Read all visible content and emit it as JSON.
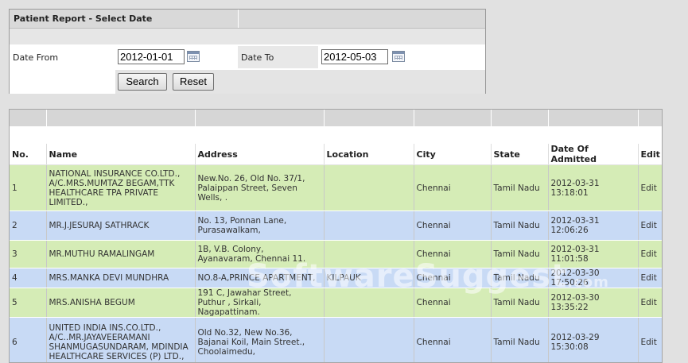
{
  "filter": {
    "title": "Patient Report - Select Date",
    "date_from_label": "Date From",
    "date_from_value": "2012-01-01",
    "date_to_label": "Date To",
    "date_to_value": "2012-05-03",
    "search_label": "Search",
    "reset_label": "Reset"
  },
  "table": {
    "columns": [
      "No.",
      "Name",
      "Address",
      "Location",
      "City",
      "State",
      "Date Of Admitted",
      "Edit"
    ],
    "rows": [
      {
        "no": "1",
        "name": "NATIONAL INSURANCE CO.LTD., A/C.MRS.MUMTAZ BEGAM,TTK HEALTHCARE TPA PRIVATE LIMITED.,",
        "address": "New.No. 26, Old No. 37/1, Palaippan Street, Seven Wells, .",
        "location": "",
        "city": "Chennai",
        "state": "Tamil Nadu",
        "date": "2012-03-31 13:18:01",
        "edit": "Edit"
      },
      {
        "no": "2",
        "name": "MR.J.JESURAJ SATHRACK",
        "address": "No. 13, Ponnan Lane, Purasawalkam,",
        "location": "",
        "city": "Chennai",
        "state": "Tamil Nadu",
        "date": "2012-03-31 12:06:26",
        "edit": "Edit"
      },
      {
        "no": "3",
        "name": "MR.MUTHU RAMALINGAM",
        "address": "1B, V.B. Colony, Ayanavaram, Chennai 11.",
        "location": "",
        "city": "Chennai",
        "state": "Tamil Nadu",
        "date": "2012-03-31 11:01:58",
        "edit": "Edit"
      },
      {
        "no": "4",
        "name": "MRS.MANKA DEVI MUNDHRA",
        "address": "NO.8-A,PRINCE APARTMENT,",
        "location": "KILPAUK",
        "city": "Chennai",
        "state": "Tamil Nadu",
        "date": "2012-03-30 17:50:26",
        "edit": "Edit"
      },
      {
        "no": "5",
        "name": "MRS.ANISHA BEGUM",
        "address": "191 C, Jawahar Street, Puthur , Sirkali, Nagapattinam.",
        "location": "",
        "city": "Chennai",
        "state": "Tamil Nadu",
        "date": "2012-03-30 13:35:22",
        "edit": "Edit"
      },
      {
        "no": "6",
        "name": "UNITED INDIA INS.CO.LTD., A/C..MR.JAYAVEERAMANI SHANMUGASUNDARAM, MDINDIA HEALTHCARE SERVICES (P) LTD.,",
        "address": "Old No.32, New No.36, Bajanai Koil, Main Street., Choolaimedu,",
        "location": "",
        "city": "Chennai",
        "state": "Tamil Nadu",
        "date": "2012-03-29 15:30:08",
        "edit": "Edit"
      }
    ]
  },
  "watermark": {
    "main": "SoftwareSuggest",
    "suffix": ".com"
  },
  "colors": {
    "row_green": "#d5ecb6",
    "row_blue": "#c8daf5",
    "header_band": "#d6d6d6"
  }
}
